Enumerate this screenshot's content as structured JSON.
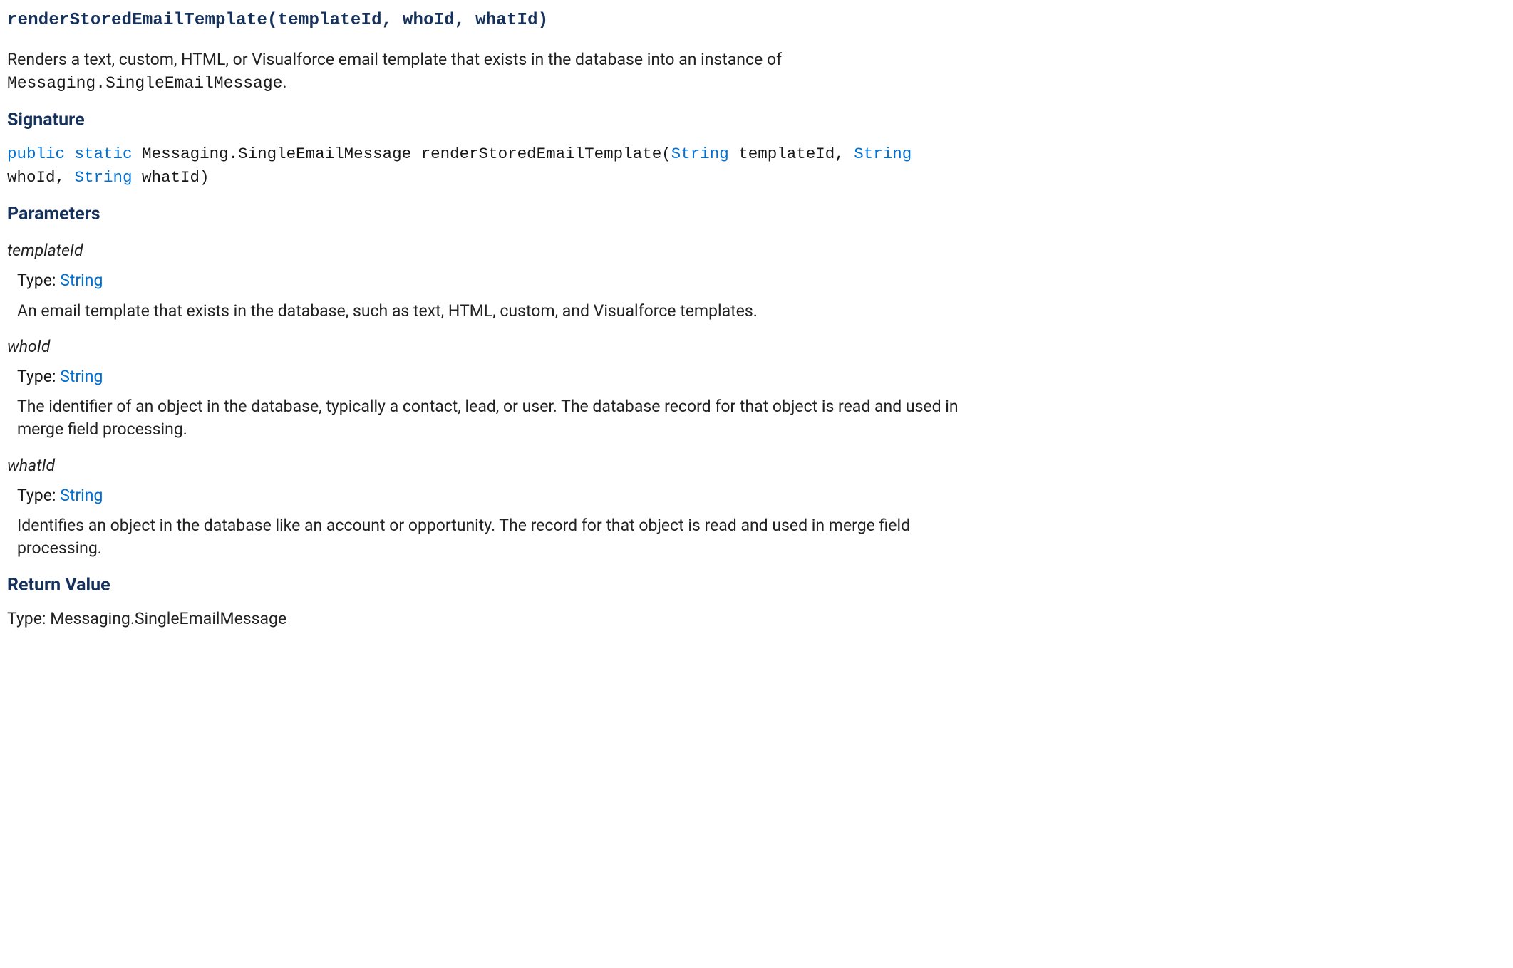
{
  "method_title": "renderStoredEmailTemplate(templateId, whoId, whatId)",
  "description_part1": "Renders a text, custom, HTML, or Visualforce email template that exists in the database into an instance of ",
  "description_code": "Messaging.SingleEmailMessage",
  "description_part2": ".",
  "sections": {
    "signature": "Signature",
    "parameters": "Parameters",
    "return_value": "Return Value"
  },
  "signature": {
    "kw_public": "public",
    "kw_static": "static",
    "return_type": "Messaging.SingleEmailMessage",
    "method_name": "renderStoredEmailTemplate(",
    "p1_type": "String",
    "p1_name": " templateId, ",
    "p2_type": "String",
    "p2_name": " whoId, ",
    "p3_type": "String",
    "p3_name": " whatId)"
  },
  "type_label": "Type: ",
  "type_link_text": "String",
  "parameters": [
    {
      "name": "templateId",
      "desc": "An email template that exists in the database, such as text, HTML, custom, and Visualforce templates."
    },
    {
      "name": "whoId",
      "desc": "The identifier of an object in the database, typically a contact, lead, or user. The database record for that object is read and used in merge field processing."
    },
    {
      "name": "whatId",
      "desc": "Identifies an object in the database like an account or opportunity. The record for that object is read and used in merge field processing."
    }
  ],
  "return_value": {
    "label": "Type: ",
    "value": "Messaging.SingleEmailMessage"
  }
}
